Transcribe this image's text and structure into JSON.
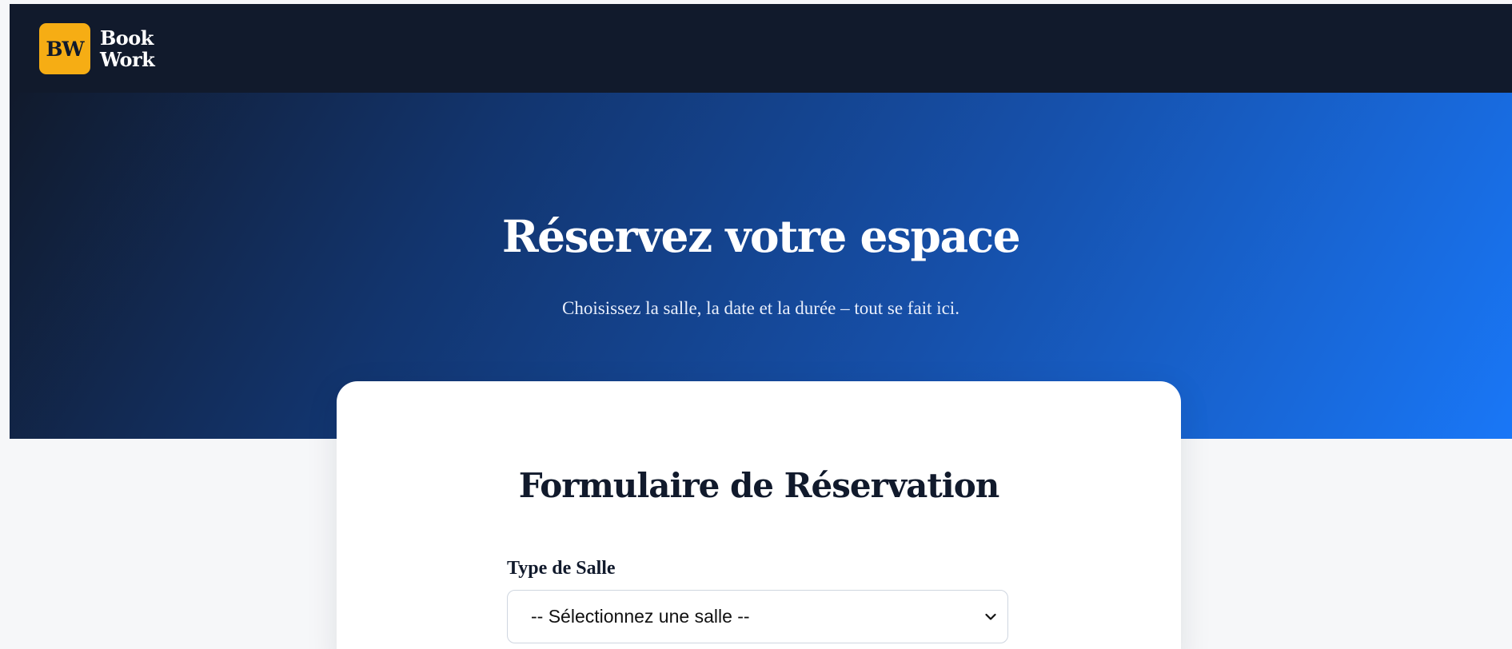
{
  "brand": {
    "badge": "BW",
    "name_line1": "Book",
    "name_line2": "Work",
    "accent_color": "#f6ad14",
    "nav_color": "#111a2c"
  },
  "hero": {
    "title": "Réservez votre espace",
    "subtitle": "Choisissez la salle, la date et la durée – tout se fait ici.",
    "gradient_start": "#111a2c",
    "gradient_end": "#1977f7"
  },
  "form": {
    "title": "Formulaire de Réservation",
    "room_type_label": "Type de Salle",
    "room_type_selected": "-- Sélectionnez une salle --",
    "room_type_icon": "chevron-down-icon"
  }
}
